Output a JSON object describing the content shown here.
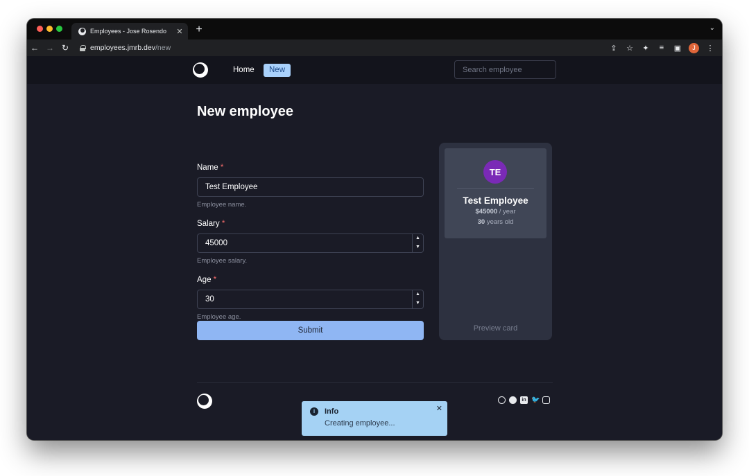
{
  "browser": {
    "tab_title": "Employees - Jose Rosendo",
    "tab_close": "✕",
    "new_tab": "+",
    "url_host": "employees.jmrb.dev",
    "url_path": "/new",
    "profile_initial": "J"
  },
  "nav": {
    "home": "Home",
    "new": "New",
    "search_placeholder": "Search employee"
  },
  "page": {
    "title": "New employee"
  },
  "form": {
    "name": {
      "label": "Name",
      "required": "*",
      "value": "Test Employee",
      "help": "Employee name."
    },
    "salary": {
      "label": "Salary",
      "required": "*",
      "value": "45000",
      "help": "Employee salary."
    },
    "age": {
      "label": "Age",
      "required": "*",
      "value": "30",
      "help": "Employee age."
    },
    "submit": "Submit"
  },
  "preview": {
    "initials": "TE",
    "name": "Test Employee",
    "salary": "$45000",
    "salary_suffix": " / year",
    "age": "30",
    "age_suffix": " years old",
    "caption": "Preview card"
  },
  "toast": {
    "icon": "i",
    "title": "Info",
    "message": "Creating employee...",
    "close": "✕"
  },
  "colors": {
    "accent": "#a9d1fb",
    "submit": "#8fb6f3",
    "avatar": "#7a2ab6",
    "required": "#f26b6b",
    "toast": "#a5d2f4"
  },
  "icons": [
    "back-arrow-icon",
    "forward-arrow-icon",
    "reload-icon",
    "lock-icon",
    "share-icon",
    "star-icon",
    "extensions-icon",
    "media-icon",
    "sidebar-icon",
    "more-icon",
    "globe-icon",
    "github-icon",
    "linkedin-icon",
    "twitter-icon",
    "instagram-icon",
    "info-icon",
    "close-icon"
  ]
}
